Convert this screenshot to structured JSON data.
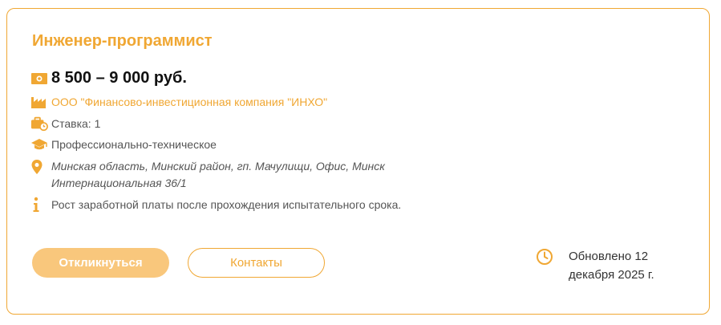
{
  "vacancy": {
    "title": "Инженер-программист",
    "salary": "8 500 – 9 000 руб.",
    "company": "ООО \"Финансово-инвестиционная компания \"ИНХО\"",
    "rate": "Ставка: 1",
    "education": "Профессионально-техническое",
    "address_line1": "Минская область, Минский район, гп. Мачулищи, Офис, Минск",
    "address_line2": "Интернациональная 36/1",
    "note": "Рост заработной платы после прохождения испытательного срока."
  },
  "actions": {
    "respond_label": "Откликнуться",
    "contacts_label": "Контакты"
  },
  "updated": {
    "line1": "Обновлено 12",
    "line2": "декабря 2025 г."
  },
  "icons": {
    "salary": "money-icon",
    "company": "factory-icon",
    "rate": "briefcase-clock-icon",
    "education": "graduation-cap-icon",
    "address": "location-pin-icon",
    "note": "info-icon",
    "updated": "clock-icon"
  },
  "colors": {
    "accent": "#f0a733",
    "button_fill": "#f9c77c"
  }
}
